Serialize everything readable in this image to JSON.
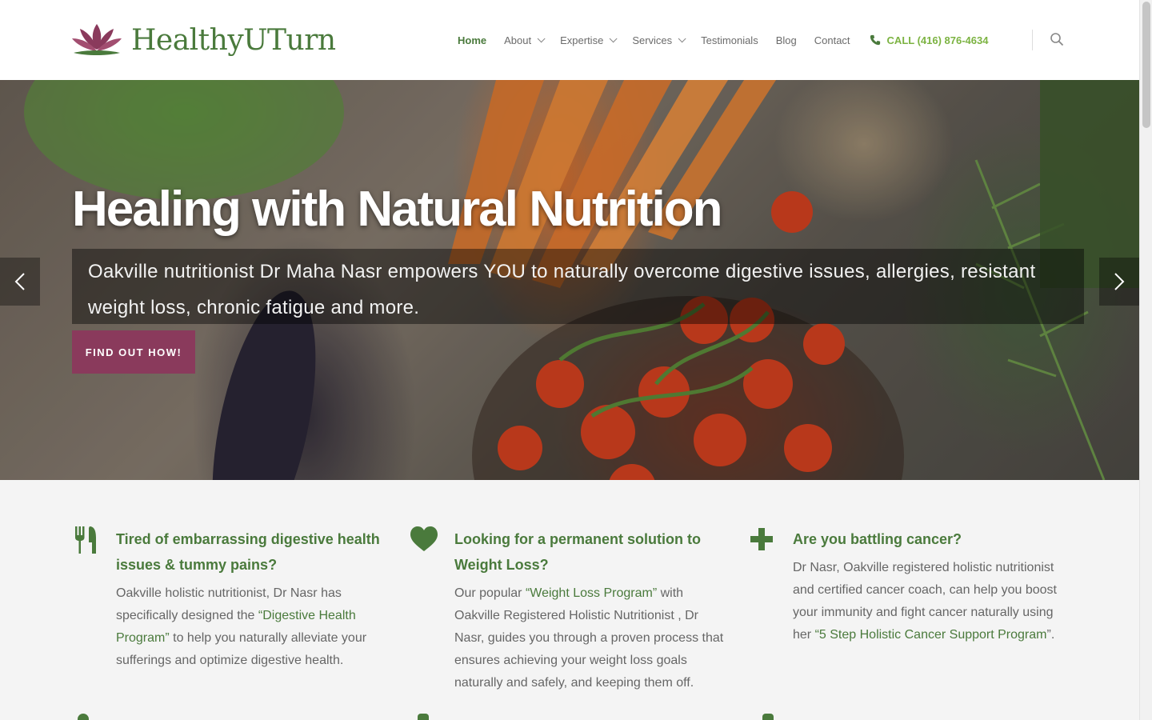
{
  "brand": {
    "name": "HealthyUTurn"
  },
  "nav": {
    "items": [
      {
        "label": "Home",
        "active": true,
        "dropdown": false
      },
      {
        "label": "About",
        "active": false,
        "dropdown": true
      },
      {
        "label": "Expertise",
        "active": false,
        "dropdown": true
      },
      {
        "label": "Services",
        "active": false,
        "dropdown": true
      },
      {
        "label": "Testimonials",
        "active": false,
        "dropdown": false
      },
      {
        "label": "Blog",
        "active": false,
        "dropdown": false
      },
      {
        "label": "Contact",
        "active": false,
        "dropdown": false
      }
    ],
    "call": "CALL (416) 876-4634"
  },
  "hero": {
    "title": "Healing with Natural Nutrition",
    "subtitle": "Oakville nutritionist Dr Maha Nasr empowers YOU to naturally overcome digestive issues, allergies, resistant weight loss, chronic fatigue and more.",
    "button": "FIND OUT HOW!"
  },
  "features": [
    {
      "icon": "utensils-icon",
      "title": "Tired of embarrassing digestive health issues & tummy pains?",
      "text_before": "Oakville holistic nutritionist, Dr Nasr has specifically designed the ",
      "link": "“Digestive Health Program”",
      "text_after": " to help you naturally alleviate your sufferings and optimize digestive health."
    },
    {
      "icon": "heart-icon",
      "title": "Looking for a permanent solution to Weight Loss?",
      "text_before": "Our popular ",
      "link": "“Weight Loss Program”",
      "text_after": " with Oakville Registered Holistic Nutritionist , Dr Nasr, guides you through a proven process that ensures achieving your weight loss goals naturally and safely, and keeping them off."
    },
    {
      "icon": "plus-icon",
      "title": "Are you battling cancer?",
      "text_before": "Dr Nasr, Oakville registered holistic nutritionist and certified cancer coach, can help you boost your immunity and fight cancer naturally using her  ",
      "link": "“5 Step Holistic Cancer Support Program",
      "text_after": "”."
    }
  ],
  "colors": {
    "brand_green": "#4a7a3c",
    "call_green": "#7cb342",
    "button_plum": "#8a3a5c"
  }
}
